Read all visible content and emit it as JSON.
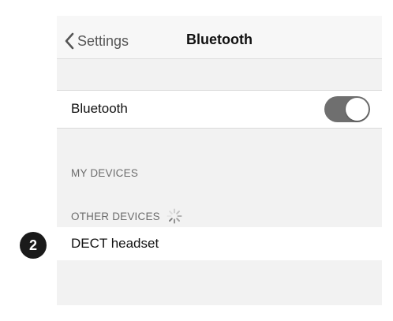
{
  "navbar": {
    "back_label": "Settings",
    "title": "Bluetooth"
  },
  "bluetooth_row": {
    "label": "Bluetooth",
    "toggle_on": true
  },
  "sections": {
    "my_devices_header": "MY DEVICES",
    "other_devices_header": "OTHER DEVICES"
  },
  "devices": [
    {
      "name": "DECT headset"
    }
  ],
  "annotation": {
    "step_number": "2"
  },
  "icons": {
    "back": "chevron-left-icon",
    "scanning": "loading-spinner-icon"
  },
  "colors": {
    "toggle_track": "#6f6f6f",
    "badge": "#1a1a1a"
  }
}
